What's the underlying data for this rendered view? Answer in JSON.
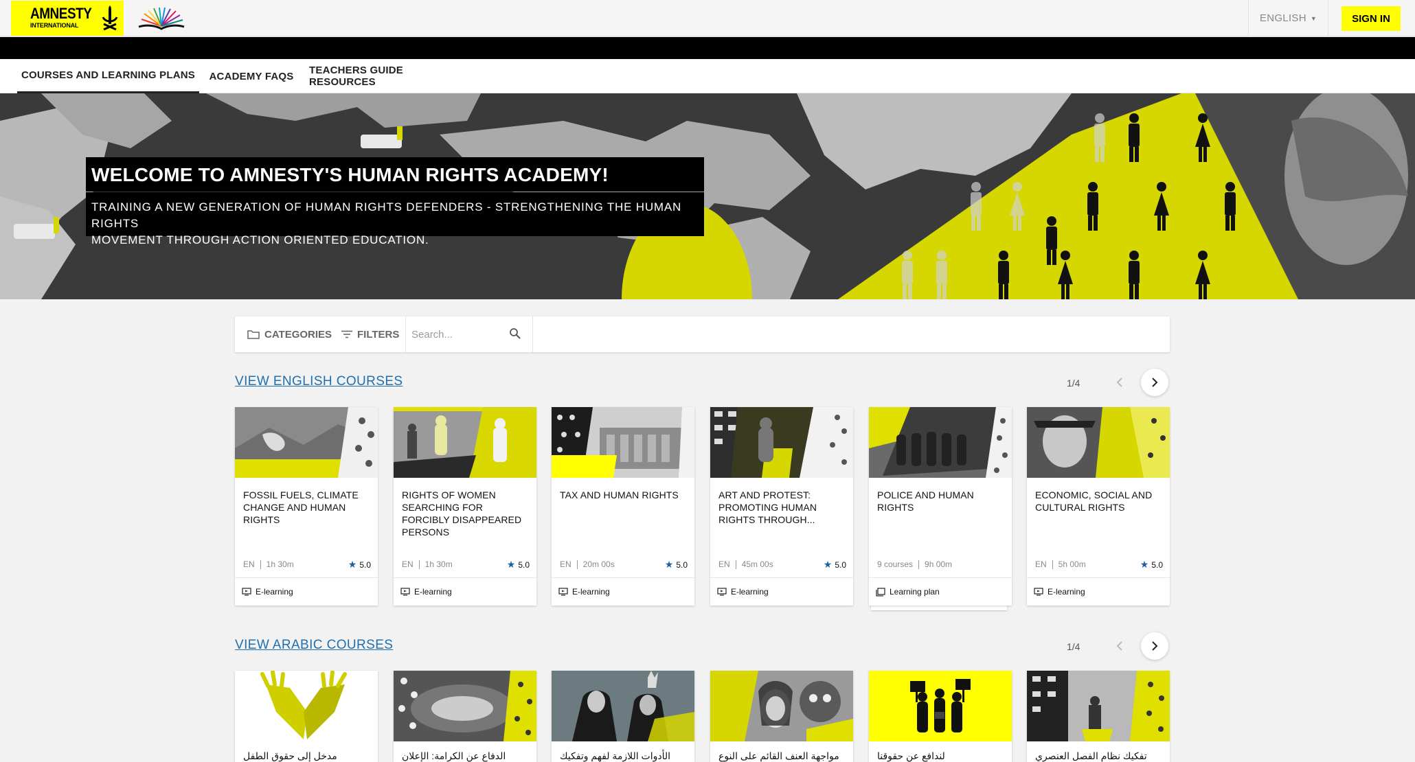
{
  "header": {
    "logo_main": "AMNESTY",
    "logo_sub": "INTERNATIONAL",
    "language": "ENGLISH",
    "sign_in": "SIGN IN"
  },
  "tabs": [
    {
      "label": "COURSES AND LEARNING PLANS",
      "active": true
    },
    {
      "label": "ACADEMY FAQS",
      "active": false
    },
    {
      "label": "TEACHERS GUIDE RESOURCES",
      "active": false
    }
  ],
  "hero": {
    "title": "WELCOME TO AMNESTY'S HUMAN RIGHTS ACADEMY!",
    "subtitle_line1": "TRAINING A NEW GENERATION OF HUMAN RIGHTS DEFENDERS - STRENGTHENING THE HUMAN RIGHTS",
    "subtitle_line2": "MOVEMENT THROUGH ACTION ORIENTED EDUCATION."
  },
  "filters": {
    "categories": "CATEGORIES",
    "filters": "FILTERS",
    "search_placeholder": "Search..."
  },
  "english_section": {
    "link": "VIEW ENGLISH COURSES",
    "pager": "1/4",
    "cards": [
      {
        "title": "FOSSIL FUELS, CLIMATE CHANGE AND HUMAN RIGHTS",
        "lang": "EN",
        "duration": "1h 30m",
        "rating": "5.0",
        "type": "E-learning"
      },
      {
        "title": "RIGHTS OF WOMEN SEARCHING FOR FORCIBLY DISAPPEARED PERSONS",
        "lang": "EN",
        "duration": "1h 30m",
        "rating": "5.0",
        "type": "E-learning"
      },
      {
        "title": "TAX AND HUMAN RIGHTS",
        "lang": "EN",
        "duration": "20m 00s",
        "rating": "5.0",
        "type": "E-learning"
      },
      {
        "title": "ART AND PROTEST: PROMOTING HUMAN RIGHTS THROUGH...",
        "lang": "EN",
        "duration": "45m 00s",
        "rating": "5.0",
        "type": "E-learning"
      },
      {
        "title": "POLICE AND HUMAN RIGHTS",
        "lang": "9 courses",
        "duration": "9h 00m",
        "rating": "",
        "type": "Learning plan"
      },
      {
        "title": "ECONOMIC, SOCIAL AND CULTURAL RIGHTS",
        "lang": "EN",
        "duration": "5h 00m",
        "rating": "5.0",
        "type": "E-learning"
      }
    ]
  },
  "arabic_section": {
    "link": "VIEW ARABIC COURSES",
    "pager": "1/4",
    "cards": [
      {
        "title": "مدخل إلى حقوق الطفل"
      },
      {
        "title": "الدفاع عن الكرامة: الإعلان العالمي"
      },
      {
        "title": "الأدوات اللازمة لفهم وتفكيك نظام"
      },
      {
        "title": "مواجهة العنف القائم على النوع"
      },
      {
        "title": "لندافع عن حقوقنا"
      },
      {
        "title": "تفكيك نظام الفصل العنصري الإسرائيلي"
      }
    ]
  },
  "colors": {
    "brand_yellow": "#ffff00",
    "link_blue": "#1f6fae",
    "star_blue": "#1f5fa0"
  }
}
